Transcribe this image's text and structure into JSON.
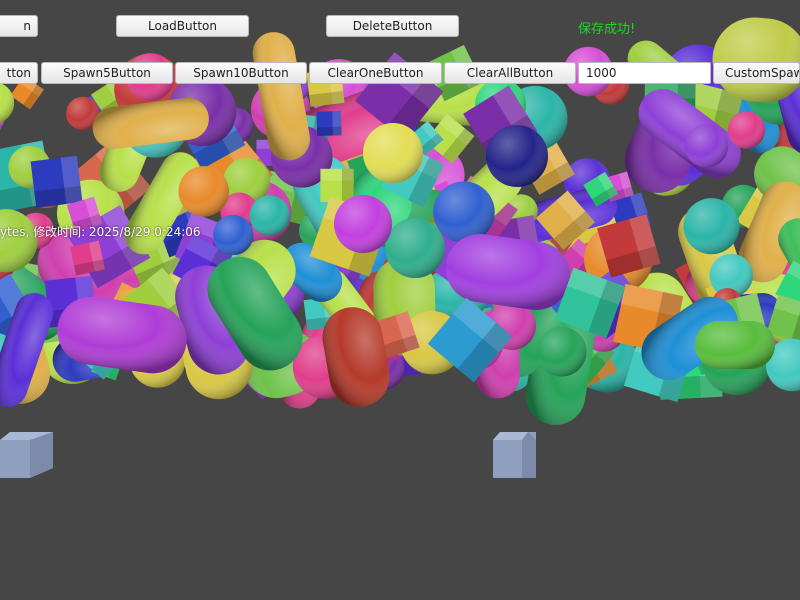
{
  "toolbar_row1": {
    "partial_button_label": "n",
    "load_label": "LoadButton",
    "delete_label": "DeleteButton",
    "save_status": "保存成功!"
  },
  "toolbar_row2": {
    "partial_button_label": "tton",
    "spawn5_label": "Spawn5Button",
    "spawn10_label": "Spawn10Button",
    "clear_one_label": "ClearOneButton",
    "clear_all_label": "ClearAllButton",
    "count_value": "1000",
    "custom_spawn_label": "CustomSpawn"
  },
  "file_info": "ytes, 修改时间: 2025/8/29 0:24:06",
  "colors": {
    "background": "#464646",
    "status_green": "#21d321",
    "info_text": "#ffffff"
  }
}
